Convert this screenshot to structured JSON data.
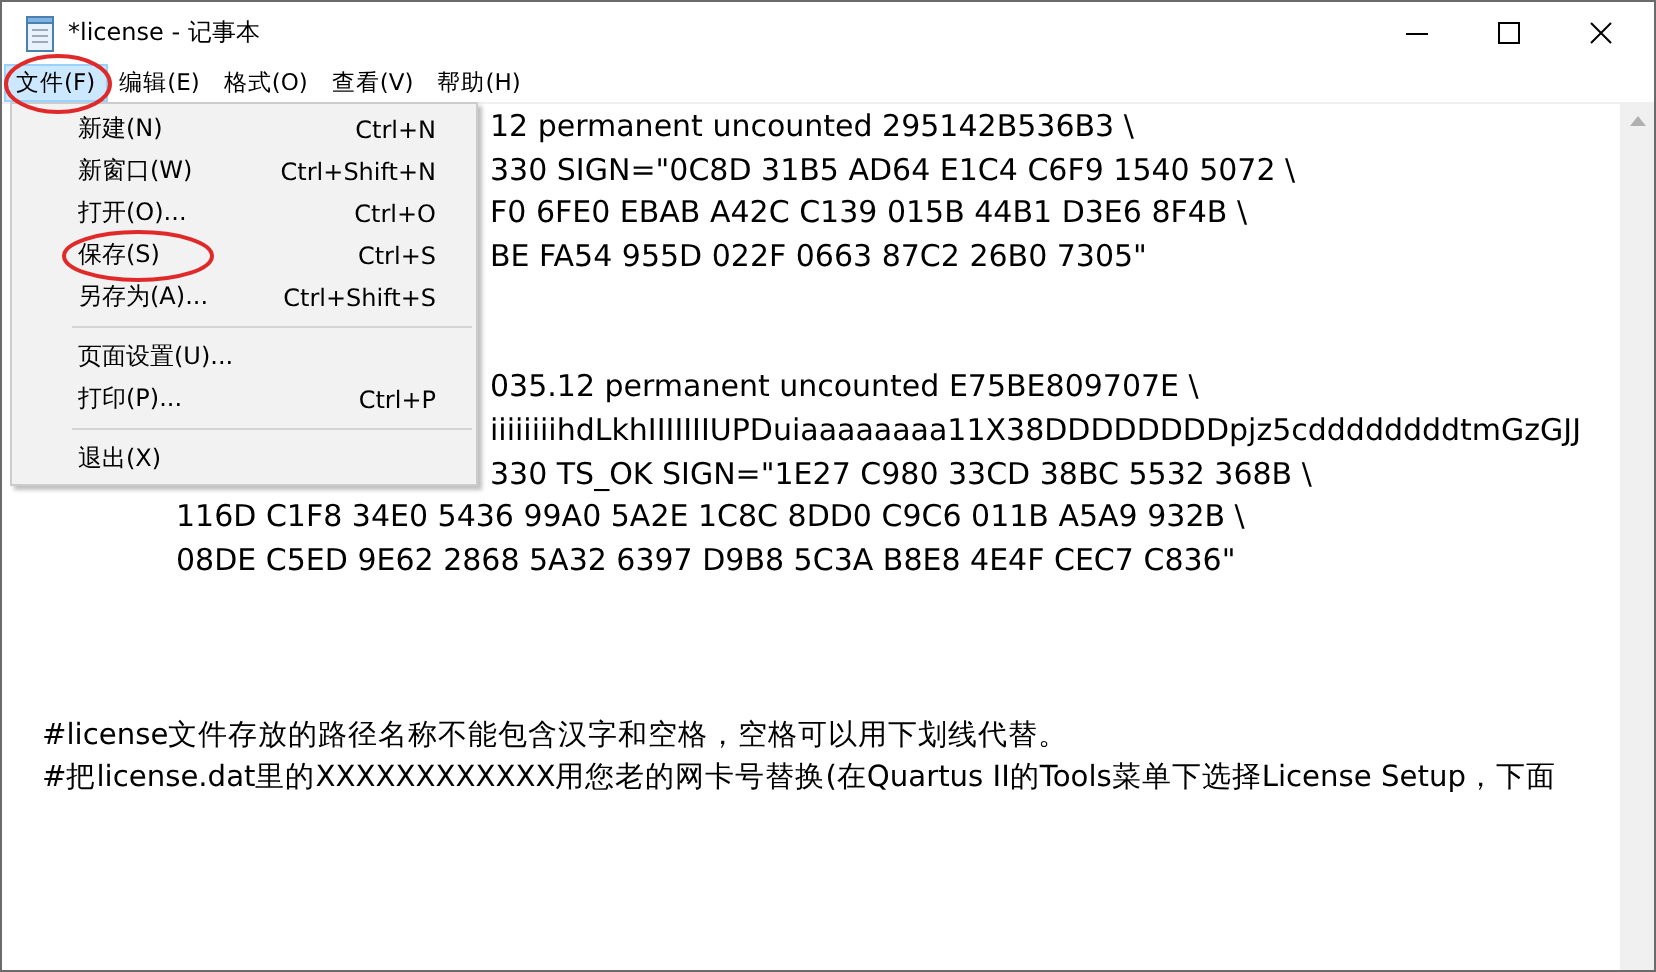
{
  "window": {
    "title": "*license - 记事本"
  },
  "menubar": [
    {
      "label": "文件(F)",
      "selected": true
    },
    {
      "label": "编辑(E)",
      "selected": false
    },
    {
      "label": "格式(O)",
      "selected": false
    },
    {
      "label": "查看(V)",
      "selected": false
    },
    {
      "label": "帮助(H)",
      "selected": false
    }
  ],
  "file_menu": [
    {
      "kind": "item",
      "label": "新建(N)",
      "shortcut": "Ctrl+N"
    },
    {
      "kind": "item",
      "label": "新窗口(W)",
      "shortcut": "Ctrl+Shift+N"
    },
    {
      "kind": "item",
      "label": "打开(O)...",
      "shortcut": "Ctrl+O"
    },
    {
      "kind": "item",
      "label": "保存(S)",
      "shortcut": "Ctrl+S",
      "circled": true
    },
    {
      "kind": "item",
      "label": "另存为(A)...",
      "shortcut": "Ctrl+Shift+S"
    },
    {
      "kind": "separator"
    },
    {
      "kind": "item",
      "label": "页面设置(U)..."
    },
    {
      "kind": "item",
      "label": "打印(P)...",
      "shortcut": "Ctrl+P"
    },
    {
      "kind": "separator"
    },
    {
      "kind": "item",
      "label": "退出(X)"
    }
  ],
  "editor_lines": [
    {
      "kind": "partial",
      "text": "12 permanent uncounted 295142B536B3 \\"
    },
    {
      "kind": "partial",
      "text": "330 SIGN=\"0C8D 31B5 AD64 E1C4 C6F9 1540 5072 \\"
    },
    {
      "kind": "partial",
      "text": "F0 6FE0 EBAB A42C C139 015B 44B1 D3E6 8F4B \\"
    },
    {
      "kind": "partial",
      "text": "BE FA54 955D 022F 0663 87C2 26B0 7305\""
    },
    {
      "kind": "blank"
    },
    {
      "kind": "blank"
    },
    {
      "kind": "partial",
      "text": "035.12 permanent uncounted E75BE809707E \\"
    },
    {
      "kind": "partial",
      "text": "iiiiiiiihdLkhIIIIIIIUPDuiaaaaaaaa11X38DDDDDDDDpjz5cddddddddtmGzGJJ"
    },
    {
      "kind": "partial",
      "text": "330 TS_OK SIGN=\"1E27 C980 33CD 38BC 5532 368B \\"
    },
    {
      "kind": "indented",
      "text": "116D C1F8 34E0 5436 99A0 5A2E 1C8C 8DD0 C9C6 011B A5A9 932B \\"
    },
    {
      "kind": "indented",
      "text": "08DE C5ED 9E62 2868 5A32 6397 D9B8 5C3A B8E8 4E4F CEC7 C836\""
    },
    {
      "kind": "blank"
    },
    {
      "kind": "blank"
    },
    {
      "kind": "blank"
    },
    {
      "kind": "plain",
      "text": "#license文件存放的路径名称不能包含汉字和空格，空格可以用下划线代替。"
    },
    {
      "kind": "plain",
      "text": "#把license.dat里的XXXXXXXXXXXX用您老的网卡号替换(在Quartus II的Tools菜单下选择License Setup，下面"
    }
  ]
}
